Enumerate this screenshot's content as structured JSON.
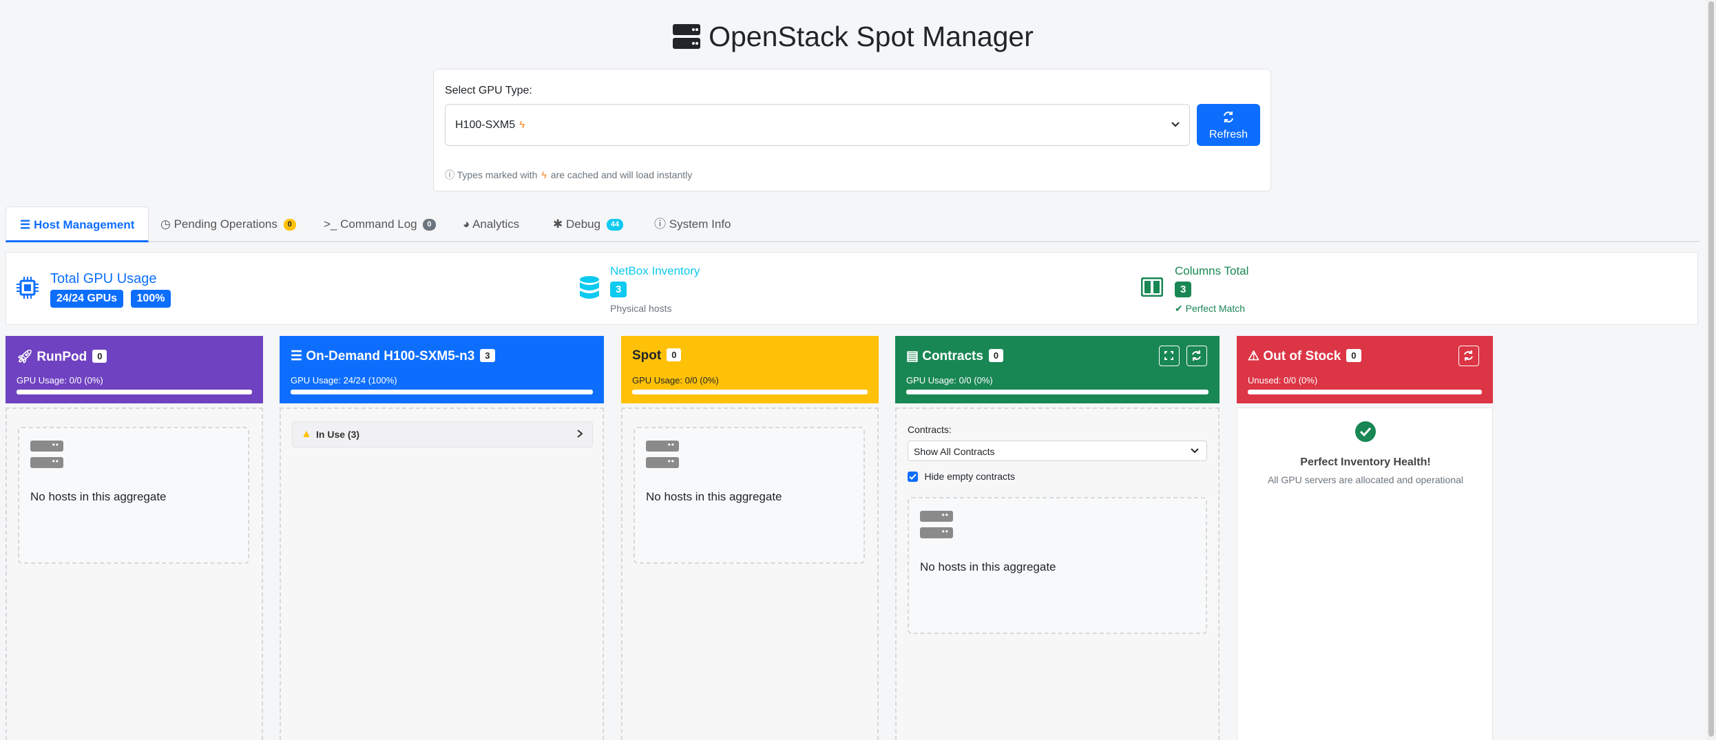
{
  "app": {
    "title": "OpenStack Spot Manager"
  },
  "selector": {
    "label": "Select GPU Type:",
    "value": "H100-SXM5",
    "refresh_label": "Refresh",
    "hint_prefix": "Types marked with",
    "hint_suffix": "are cached and will load instantly"
  },
  "tabs": [
    {
      "label": "Host Management",
      "active": true
    },
    {
      "label": "Pending Operations",
      "badge": "0"
    },
    {
      "label": "Command Log",
      "badge": "0"
    },
    {
      "label": "Analytics"
    },
    {
      "label": "Debug",
      "badge": "44"
    },
    {
      "label": "System Info"
    }
  ],
  "summary": {
    "gpu": {
      "title": "Total GPU Usage",
      "gpus": "24/24 GPUs",
      "percent": "100%"
    },
    "netbox": {
      "title": "NetBox Inventory",
      "count": "3",
      "sub": "Physical hosts"
    },
    "columns": {
      "title": "Columns Total",
      "count": "3",
      "sub": "Perfect Match"
    }
  },
  "columns": {
    "runpod": {
      "name": "RunPod",
      "count": "0",
      "usage": "GPU Usage: 0/0 (0%)",
      "fill": 1.0,
      "color": "#6f42c1",
      "empty": "No hosts in this aggregate"
    },
    "ondemand": {
      "name": "On-Demand H100-SXM5-n3",
      "count": "3",
      "usage": "GPU Usage: 24/24 (100%)",
      "fill": 1.0,
      "color": "#0d6efd",
      "group": "In Use (3)"
    },
    "spot": {
      "name": "Spot",
      "count": "0",
      "usage": "GPU Usage: 0/0 (0%)",
      "fill": 1.0,
      "color": "#ffc107",
      "empty": "No hosts in this aggregate"
    },
    "contracts": {
      "name": "Contracts",
      "count": "0",
      "usage": "GPU Usage: 0/0 (0%)",
      "fill": 1.0,
      "color": "#198754",
      "filter_label": "Contracts:",
      "filter_value": "Show All Contracts",
      "hide_label": "Hide empty contracts",
      "empty": "No hosts in this aggregate"
    },
    "oos": {
      "name": "Out of Stock",
      "count": "0",
      "usage": "Unused: 0/0 (0%)",
      "fill": 1.0,
      "color": "#dc3545",
      "health_title": "Perfect Inventory Health!",
      "health_sub": "All GPU servers are allocated and operational"
    }
  }
}
